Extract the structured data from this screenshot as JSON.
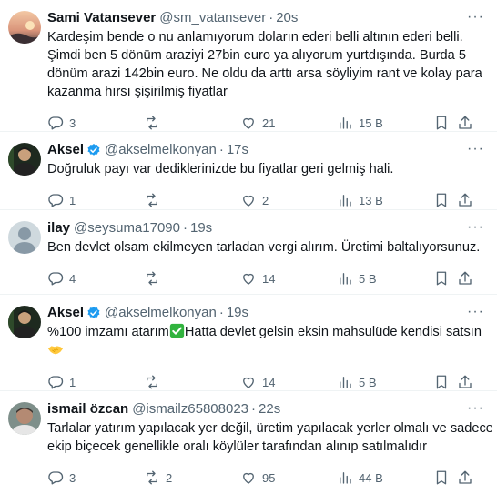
{
  "colors": {
    "text": "#0f1419",
    "muted": "#536471",
    "verified": "#1d9bf0",
    "divider": "#eff3f4"
  },
  "tweets": [
    {
      "name": "Sami Vatansever",
      "handle": "@sm_vatansever",
      "time": "20s",
      "verified": false,
      "lines": [
        "Kardeşim bende o nu anlamıyorum doların ederi belli altının ederi belli.",
        "Şimdi ben 5 dönüm araziyi 27bin euro ya alıyorum yurtdışında. Burda 5",
        "dönüm arazi 142bin euro. Ne oldu da arttı arsa söyliyim rant ve kolay para",
        "kazanma hırsı şişirilmiş fiyatlar"
      ],
      "reply": "3",
      "retweet": "",
      "like": "21",
      "views": "15 B"
    },
    {
      "name": "Aksel",
      "handle": "@akselmelkonyan",
      "time": "17s",
      "verified": true,
      "lines": [
        "Doğruluk payı var dediklerinizde bu fiyatlar geri gelmiş hali."
      ],
      "reply": "1",
      "retweet": "",
      "like": "2",
      "views": "13 B"
    },
    {
      "name": "ilay",
      "handle": "@seysuma17090",
      "time": "19s",
      "verified": false,
      "lines": [
        "Ben devlet olsam ekilmeyen tarladan vergi alırım. Üretimi baltalıyorsunuz."
      ],
      "reply": "4",
      "retweet": "",
      "like": "14",
      "views": "5 B"
    },
    {
      "name": "Aksel",
      "handle": "@akselmelkonyan",
      "time": "19s",
      "verified": true,
      "lines": [
        "%100 imzamı atarım",
        "Hatta devlet gelsin eksin mahsulüde kendisi satsın"
      ],
      "emoji": [
        "check-mark-emoji",
        "handshake-emoji"
      ],
      "reply": "1",
      "retweet": "",
      "like": "14",
      "views": "5 B"
    },
    {
      "name": "ismail özcan",
      "handle": "@ismailz65808023",
      "time": "22s",
      "verified": false,
      "lines": [
        "Tarlalar yatırım yapılacak yer değil, üretim yapılacak yerler olmalı ve sadece",
        "ekip biçecek genellikle oralı köylüler tarafından alınıp satılmalıdır"
      ],
      "reply": "3",
      "retweet": "2",
      "like": "95",
      "views": "44 B"
    }
  ],
  "dot": "·",
  "more": "···"
}
